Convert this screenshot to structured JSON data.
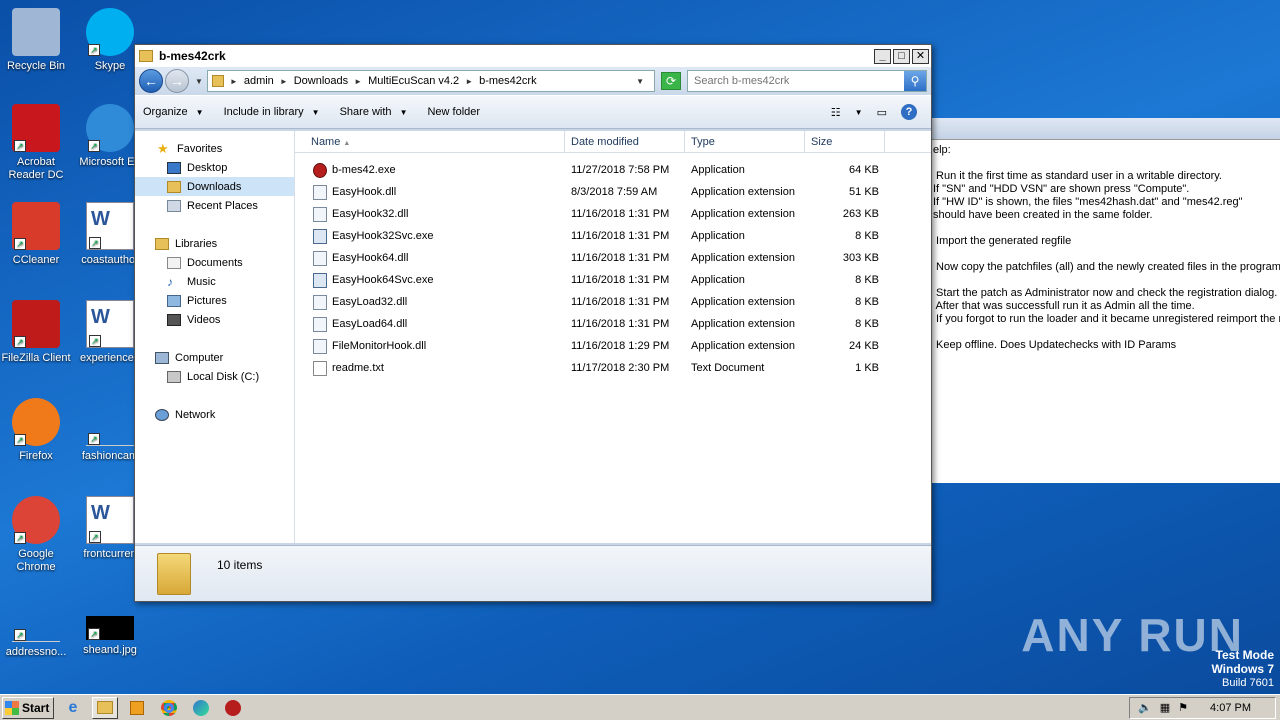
{
  "desktop_icons": [
    {
      "label": "Recycle Bin",
      "icon": "recycle-bin-icon"
    },
    {
      "label": "Skype",
      "icon": "skype-icon"
    },
    {
      "label": "Acrobat Reader DC",
      "icon": "acrobat-icon"
    },
    {
      "label": "Microsoft Ed",
      "icon": "edge-icon"
    },
    {
      "label": "CCleaner",
      "icon": "ccleaner-icon"
    },
    {
      "label": "coastauthor",
      "icon": "word-doc-icon"
    },
    {
      "label": "FileZilla Client",
      "icon": "filezilla-icon"
    },
    {
      "label": "experienceb",
      "icon": "word-doc-icon"
    },
    {
      "label": "Firefox",
      "icon": "firefox-icon"
    },
    {
      "label": "fashioncam",
      "icon": "blank-file-icon"
    },
    {
      "label": "Google Chrome",
      "icon": "chrome-icon"
    },
    {
      "label": "frontcurren",
      "icon": "word-doc-icon"
    },
    {
      "label": "addressno...",
      "icon": "blank-file-icon"
    },
    {
      "label": "sheand.jpg",
      "icon": "image-icon"
    }
  ],
  "readme": {
    "text": "elp:\n\n Run it the first time as standard user in a writable directory.\nIf \"SN\" and \"HDD VSN\" are shown press \"Compute\".\nIf \"HW ID\" is shown, the files \"mes42hash.dat\" and \"mes42.reg\"\nshould have been created in the same folder.\n\n Import the generated regfile\n\n Now copy the patchfiles (all) and the newly created files in the program fo\n\n Start the patch as Administrator now and check the registration dialog.\n After that was successfull run it as Admin all the time.\n If you forgot to run the loader and it became unregistered reimport the regf\n\n Keep offline. Does Updatechecks with ID Params"
  },
  "window": {
    "title": "b-mes42crk",
    "breadcrumb": [
      "admin",
      "Downloads",
      "MultiEcuScan v4.2",
      "b-mes42crk"
    ],
    "search_placeholder": "Search b-mes42crk",
    "toolbar": {
      "organize": "Organize",
      "include": "Include in library",
      "share": "Share with",
      "newfolder": "New folder"
    },
    "nav": {
      "favorites": "Favorites",
      "desktop": "Desktop",
      "downloads": "Downloads",
      "recent": "Recent Places",
      "libraries": "Libraries",
      "documents": "Documents",
      "music": "Music",
      "pictures": "Pictures",
      "videos": "Videos",
      "computer": "Computer",
      "localdisk": "Local Disk (C:)",
      "network": "Network"
    },
    "columns": {
      "name": "Name",
      "date": "Date modified",
      "type": "Type",
      "size": "Size"
    },
    "files": [
      {
        "name": "b-mes42.exe",
        "date": "11/27/2018 7:58 PM",
        "type": "Application",
        "size": "64 KB",
        "icon": "exe-red"
      },
      {
        "name": "EasyHook.dll",
        "date": "8/3/2018 7:59 AM",
        "type": "Application extension",
        "size": "51 KB",
        "icon": "dll"
      },
      {
        "name": "EasyHook32.dll",
        "date": "11/16/2018 1:31 PM",
        "type": "Application extension",
        "size": "263 KB",
        "icon": "dll"
      },
      {
        "name": "EasyHook32Svc.exe",
        "date": "11/16/2018 1:31 PM",
        "type": "Application",
        "size": "8 KB",
        "icon": "exe"
      },
      {
        "name": "EasyHook64.dll",
        "date": "11/16/2018 1:31 PM",
        "type": "Application extension",
        "size": "303 KB",
        "icon": "dll"
      },
      {
        "name": "EasyHook64Svc.exe",
        "date": "11/16/2018 1:31 PM",
        "type": "Application",
        "size": "8 KB",
        "icon": "exe"
      },
      {
        "name": "EasyLoad32.dll",
        "date": "11/16/2018 1:31 PM",
        "type": "Application extension",
        "size": "8 KB",
        "icon": "dll"
      },
      {
        "name": "EasyLoad64.dll",
        "date": "11/16/2018 1:31 PM",
        "type": "Application extension",
        "size": "8 KB",
        "icon": "dll"
      },
      {
        "name": "FileMonitorHook.dll",
        "date": "11/16/2018 1:29 PM",
        "type": "Application extension",
        "size": "24 KB",
        "icon": "dll"
      },
      {
        "name": "readme.txt",
        "date": "11/17/2018 2:30 PM",
        "type": "Text Document",
        "size": "1 KB",
        "icon": "txt"
      }
    ],
    "status": "10 items"
  },
  "taskbar": {
    "start": "Start",
    "clock": "4:07 PM"
  },
  "watermark": "ANY RUN",
  "testmode": {
    "line1": "Test Mode",
    "line2": "Windows 7",
    "line3": "Build 7601"
  }
}
